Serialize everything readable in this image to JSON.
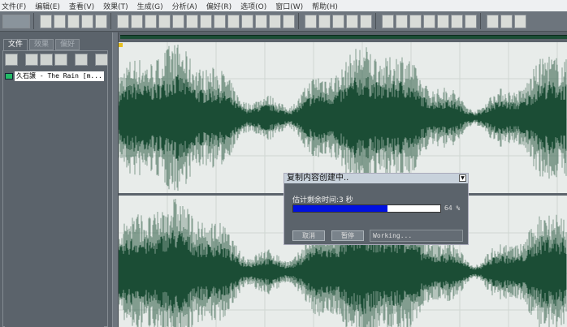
{
  "menu": [
    "文件(F)",
    "编辑(E)",
    "查看(V)",
    "效果(T)",
    "生成(G)",
    "分析(A)",
    "偏好(R)",
    "选项(O)",
    "窗口(W)",
    "帮助(H)"
  ],
  "toolbar_icons": [
    "mode-switch",
    "new-file",
    "open-file",
    "save",
    "save-as",
    "save-all",
    "undo",
    "redo",
    "repeat",
    "select",
    "copy",
    "cut",
    "paste",
    "paste-new",
    "mix-paste",
    "trim",
    "snap",
    "toggle-edit",
    "marker",
    "channel-left",
    "channel-both",
    "channel-right",
    "view-a",
    "view-b",
    "view-c",
    "play",
    "zoom",
    "time-display",
    "sample-display",
    "level-meter",
    "blank",
    "favorites",
    "settings",
    "help"
  ],
  "left_panel": {
    "tabs": [
      "文件",
      "效果",
      "偏好"
    ],
    "active_tab": "文件",
    "tools": [
      "open",
      "close",
      "insert",
      "mix",
      "edit",
      "help"
    ],
    "files": [
      "久石譲 - The Rain [m..."
    ]
  },
  "dialog": {
    "title": "复制内容创建中..",
    "estimate": "估计剩余时间:3 秒",
    "progress_percent": 64,
    "progress_label": "64 %",
    "cancel": "取消",
    "pause": "暂停",
    "status": "Working...",
    "progress_color": "#0010e0"
  },
  "colors": {
    "waveform": "#1b4d35",
    "background": "#e8ecea"
  }
}
